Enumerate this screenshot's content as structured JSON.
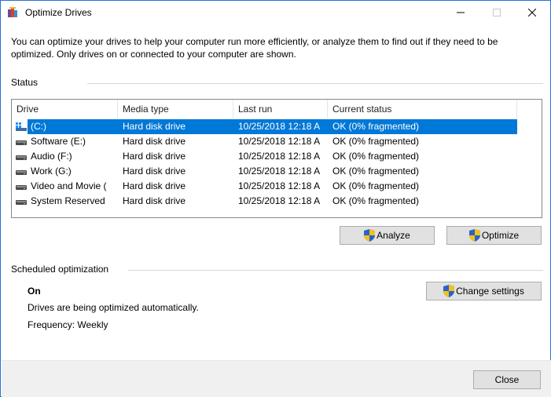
{
  "window": {
    "title": "Optimize Drives",
    "controls": {
      "minimize": "—",
      "maximize": "☐",
      "close": "✕"
    }
  },
  "intro_text": "You can optimize your drives to help your computer run more efficiently, or analyze them to find out if they need to be optimized. Only drives on or connected to your computer are shown.",
  "status": {
    "label": "Status",
    "columns": [
      "Drive",
      "Media type",
      "Last run",
      "Current status"
    ],
    "rows": [
      {
        "drive": "(C:)",
        "media_type": "Hard disk drive",
        "last_run": "10/25/2018 12:18 A",
        "status": "OK (0% fragmented)",
        "icon": "system-drive-icon",
        "selected": true
      },
      {
        "drive": "Software (E:)",
        "media_type": "Hard disk drive",
        "last_run": "10/25/2018 12:18 A",
        "status": "OK (0% fragmented)",
        "icon": "hard-drive-icon",
        "selected": false
      },
      {
        "drive": "Audio (F:)",
        "media_type": "Hard disk drive",
        "last_run": "10/25/2018 12:18 A",
        "status": "OK (0% fragmented)",
        "icon": "hard-drive-icon",
        "selected": false
      },
      {
        "drive": "Work (G:)",
        "media_type": "Hard disk drive",
        "last_run": "10/25/2018 12:18 A",
        "status": "OK (0% fragmented)",
        "icon": "hard-drive-icon",
        "selected": false
      },
      {
        "drive": "Video and Movie (",
        "media_type": "Hard disk drive",
        "last_run": "10/25/2018 12:18 A",
        "status": "OK (0% fragmented)",
        "icon": "hard-drive-icon",
        "selected": false
      },
      {
        "drive": "System Reserved",
        "media_type": "Hard disk drive",
        "last_run": "10/25/2018 12:18 A",
        "status": "OK (0% fragmented)",
        "icon": "hard-drive-icon",
        "selected": false
      }
    ],
    "analyze_label": "Analyze",
    "optimize_label": "Optimize"
  },
  "scheduled": {
    "label": "Scheduled optimization",
    "state": "On",
    "description": "Drives are being optimized automatically.",
    "frequency": "Frequency: Weekly",
    "change_settings_label": "Change settings"
  },
  "footer": {
    "close_label": "Close"
  },
  "colors": {
    "selection": "#0078d7",
    "accent_border": "#2b6fd6",
    "footer_bg": "#f0f0f0",
    "button_bg": "#e1e1e1"
  }
}
